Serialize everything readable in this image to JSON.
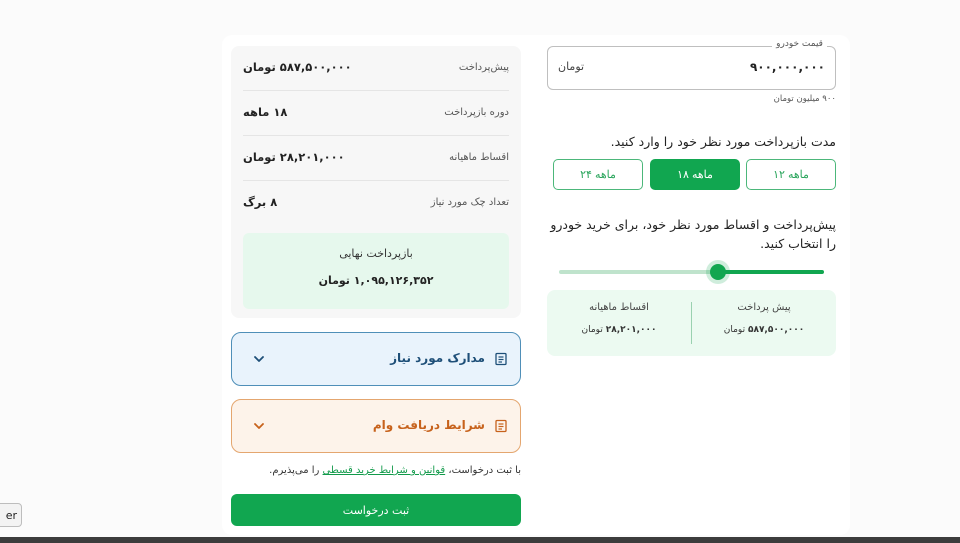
{
  "price": {
    "legend": "قیمت خودرو",
    "value": "۹۰۰,۰۰۰,۰۰۰",
    "unit": "تومان",
    "hint": "۹۰۰ میلیون تومان"
  },
  "duration": {
    "title": "مدت بازپرداخت مورد نظر خود را وارد کنید.",
    "options": [
      "۱۲ ماهه",
      "۱۸ ماهه",
      "۲۴ ماهه"
    ],
    "selected": "۱۸ ماهه"
  },
  "choose_title": "پیش‌پرداخت و اقساط مورد نظر خود، برای خرید خودرو را انتخاب کنید.",
  "slider": {
    "value_fraction": 0.6
  },
  "summary": {
    "down_label": "پیش پرداخت",
    "down_value": "۵۸۷,۵۰۰,۰۰۰",
    "down_unit": "تومان",
    "monthly_label": "اقساط ماهیانه",
    "monthly_value": "۲۸,۲۰۱,۰۰۰",
    "monthly_unit": "تومان"
  },
  "details": {
    "rows": [
      {
        "label": "پیش‌پرداخت",
        "value": "۵۸۷,۵۰۰,۰۰۰ تومان"
      },
      {
        "label": "دوره بازپرداخت",
        "value": "۱۸ ماهه"
      },
      {
        "label": "اقساط ماهیانه",
        "value": "۲۸,۲۰۱,۰۰۰ تومان"
      },
      {
        "label": "تعداد چک مورد نیاز",
        "value": "۸ برگ"
      }
    ],
    "final_label": "بازپرداخت نهایی",
    "final_value": "۱,۰۹۵,۱۲۶,۳۵۲ تومان"
  },
  "accordions": {
    "documents": "مدارک مورد نیاز",
    "loan_terms": "شرایط دریافت وام"
  },
  "terms": {
    "prefix": "با ثبت درخواست،",
    "link": "قوانین و شرایط خرید قسطی",
    "suffix": "را می‌پذیرم."
  },
  "submit_label": "ثبت درخواست",
  "side_tab_label": "er",
  "colors": {
    "accent": "#11a650",
    "blue": "#4f8fb8",
    "orange": "#e4a66f"
  }
}
